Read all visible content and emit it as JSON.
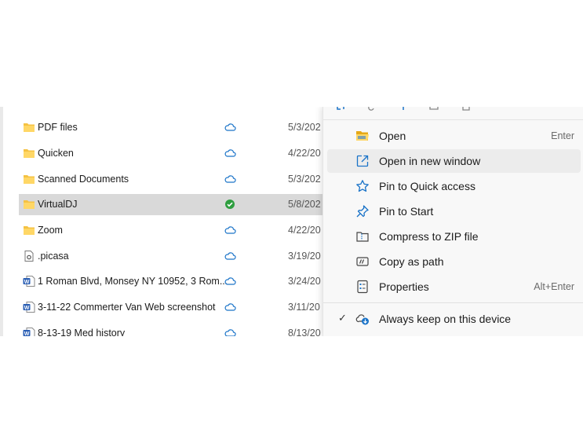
{
  "file_list": {
    "rows": [
      {
        "name": "PDF files",
        "date": "5/3/202",
        "type": "folder",
        "status": "cloud",
        "selected": false
      },
      {
        "name": "Quicken",
        "date": "4/22/20",
        "type": "folder",
        "status": "cloud",
        "selected": false
      },
      {
        "name": "Scanned Documents",
        "date": "5/3/202",
        "type": "folder",
        "status": "cloud",
        "selected": false
      },
      {
        "name": "VirtualDJ",
        "date": "5/8/202",
        "type": "folder",
        "status": "synced",
        "selected": true
      },
      {
        "name": "Zoom",
        "date": "4/22/20",
        "type": "folder",
        "status": "cloud",
        "selected": false
      },
      {
        "name": ".picasa",
        "date": "3/19/20",
        "type": "file",
        "status": "cloud",
        "selected": false
      },
      {
        "name": "1 Roman Blvd, Monsey NY 10952, 3 Rom...",
        "date": "3/24/20",
        "type": "word",
        "status": "cloud",
        "selected": false
      },
      {
        "name": "3-11-22 Commerter Van Web screenshot",
        "date": "3/11/20",
        "type": "word",
        "status": "cloud",
        "selected": false
      },
      {
        "name": "8-13-19 Med history",
        "date": "8/13/20",
        "type": "word",
        "status": "cloud",
        "selected": false
      }
    ]
  },
  "context_menu": {
    "items": [
      {
        "label": "Open",
        "shortcut": "Enter",
        "icon": "folder-open-icon"
      },
      {
        "label": "Open in new window",
        "shortcut": "",
        "icon": "open-new-window-icon",
        "hover": true
      },
      {
        "label": "Pin to Quick access",
        "shortcut": "",
        "icon": "star-icon"
      },
      {
        "label": "Pin to Start",
        "shortcut": "",
        "icon": "pin-icon"
      },
      {
        "label": "Compress to ZIP file",
        "shortcut": "",
        "icon": "zip-icon"
      },
      {
        "label": "Copy as path",
        "shortcut": "",
        "icon": "copy-path-icon"
      },
      {
        "label": "Properties",
        "shortcut": "Alt+Enter",
        "icon": "properties-icon"
      }
    ],
    "bottom_item": {
      "label": "Always keep on this device",
      "checked": true,
      "icon": "cloud-download-icon"
    }
  },
  "colors": {
    "accent": "#1a73c8",
    "folder": "#f5c242",
    "synced": "#2e9e3f",
    "selection": "#d9d9d9"
  }
}
